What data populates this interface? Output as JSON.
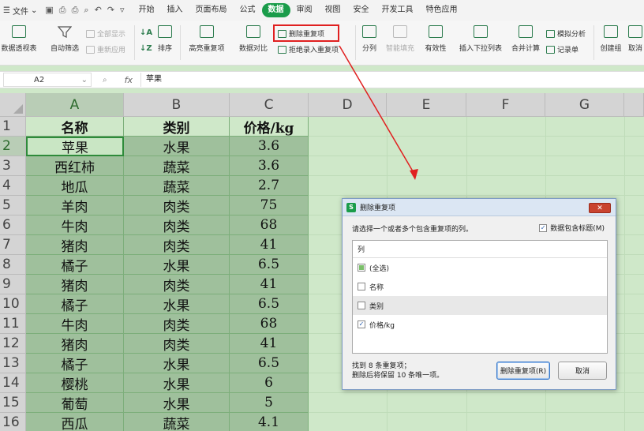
{
  "menubar": {
    "file_label": "文件",
    "tabs": [
      "开始",
      "插入",
      "页面布局",
      "公式",
      "数据",
      "审阅",
      "视图",
      "安全",
      "开发工具",
      "特色应用"
    ],
    "active_tab": "数据"
  },
  "ribbon": {
    "pivot": "数据透视表",
    "autofilter": "自动筛选",
    "show_all": "全部显示",
    "reapply": "重新应用",
    "sort": "排序",
    "highlight_dup": "高亮重复项",
    "compare": "数据对比",
    "remove_dup": "删除重复项",
    "reject_dup": "拒绝录入重复项",
    "split": "分列",
    "smart_fill": "智能填充",
    "validity": "有效性",
    "dropdown": "插入下拉列表",
    "consolidate": "合并计算",
    "simulate": "模拟分析",
    "record": "记录单",
    "group": "创建组",
    "ungroup": "取消"
  },
  "formula_bar": {
    "cell_ref": "A2",
    "fx": "fx",
    "value": "苹果"
  },
  "sheet": {
    "columns": [
      "A",
      "B",
      "C",
      "D",
      "E",
      "F",
      "G"
    ],
    "rows": [
      "1",
      "2",
      "3",
      "4",
      "5",
      "6",
      "7",
      "8",
      "9",
      "10",
      "11",
      "12",
      "13",
      "14",
      "15",
      "16"
    ],
    "header": [
      "名称",
      "类别",
      "价格/kg"
    ],
    "data": [
      [
        "苹果",
        "水果",
        "3.6"
      ],
      [
        "西红柿",
        "蔬菜",
        "3.6"
      ],
      [
        "地瓜",
        "蔬菜",
        "2.7"
      ],
      [
        "羊肉",
        "肉类",
        "75"
      ],
      [
        "牛肉",
        "肉类",
        "68"
      ],
      [
        "猪肉",
        "肉类",
        "41"
      ],
      [
        "橘子",
        "水果",
        "6.5"
      ],
      [
        "猪肉",
        "肉类",
        "41"
      ],
      [
        "橘子",
        "水果",
        "6.5"
      ],
      [
        "牛肉",
        "肉类",
        "68"
      ],
      [
        "猪肉",
        "肉类",
        "41"
      ],
      [
        "橘子",
        "水果",
        "6.5"
      ],
      [
        "樱桃",
        "水果",
        "6"
      ],
      [
        "葡萄",
        "水果",
        "5"
      ],
      [
        "西瓜",
        "蔬菜",
        "4.1"
      ]
    ]
  },
  "dialog": {
    "title": "删除重复项",
    "close": "✕",
    "prompt": "请选择一个或者多个包含重复项的列。",
    "has_header_label": "数据包含标题(M)",
    "has_header_checked": true,
    "list_header": "列",
    "items": [
      {
        "label": "(全选)",
        "state": "partial"
      },
      {
        "label": "名称",
        "state": "unchecked"
      },
      {
        "label": "类别",
        "state": "unchecked"
      },
      {
        "label": "价格/kg",
        "state": "checked"
      }
    ],
    "found_line1": "找到 8 条重复项；",
    "found_line2": "删除后将保留 10 条唯一项。",
    "ok_button": "删除重复项(R)",
    "cancel_button": "取消"
  },
  "colors": {
    "accent": "#1a9c4a",
    "annotation": "#e02020"
  }
}
